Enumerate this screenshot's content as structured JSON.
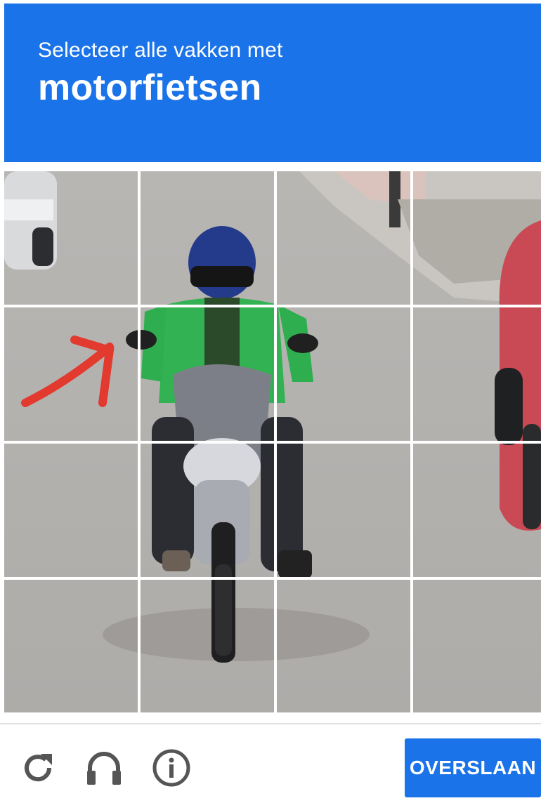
{
  "captcha": {
    "instruction": "Selecteer alle vakken met",
    "target": "motorfietsen",
    "skip_label": "OVERSLAAN",
    "accent_color": "#1a73e8",
    "grid": {
      "rows": 4,
      "cols": 4,
      "selected_tiles": []
    },
    "icons": {
      "reload": "reload-icon",
      "audio": "headphones-icon",
      "info": "info-icon"
    }
  }
}
